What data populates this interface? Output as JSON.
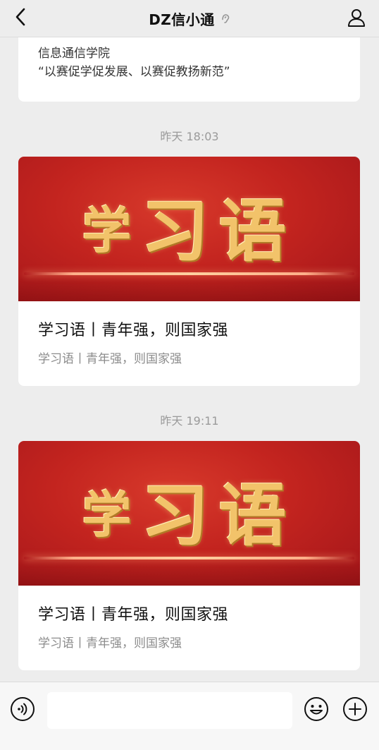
{
  "header": {
    "title": "DZ信小通",
    "back_icon": "chevron-left-icon",
    "ear_icon": "ear-icon",
    "profile_icon": "user-icon"
  },
  "top_card": {
    "line1": "信息通信学院",
    "line2": "“以赛促学促发展、以赛促教扬新范”"
  },
  "messages": [
    {
      "timestamp": "昨天 18:03",
      "banner_text_a": "学",
      "banner_text_b": "习语",
      "title": "学习语丨青年强，则国家强",
      "subtitle": "学习语丨青年强，则国家强"
    },
    {
      "timestamp": "昨天 19:11",
      "banner_text_a": "学",
      "banner_text_b": "习语",
      "title": "学习语丨青年强，则国家强",
      "subtitle": "学习语丨青年强，则国家强"
    }
  ],
  "bottom_bar": {
    "voice_icon": "voice-icon",
    "input_placeholder": "",
    "emoji_icon": "emoji-icon",
    "plus_icon": "plus-icon"
  },
  "colors": {
    "background": "#ededed",
    "card": "#ffffff",
    "banner_red": "#c3241f",
    "gold": "#f2c36a",
    "muted_text": "#8c8c8c",
    "timestamp_text": "#9a9a9a"
  }
}
